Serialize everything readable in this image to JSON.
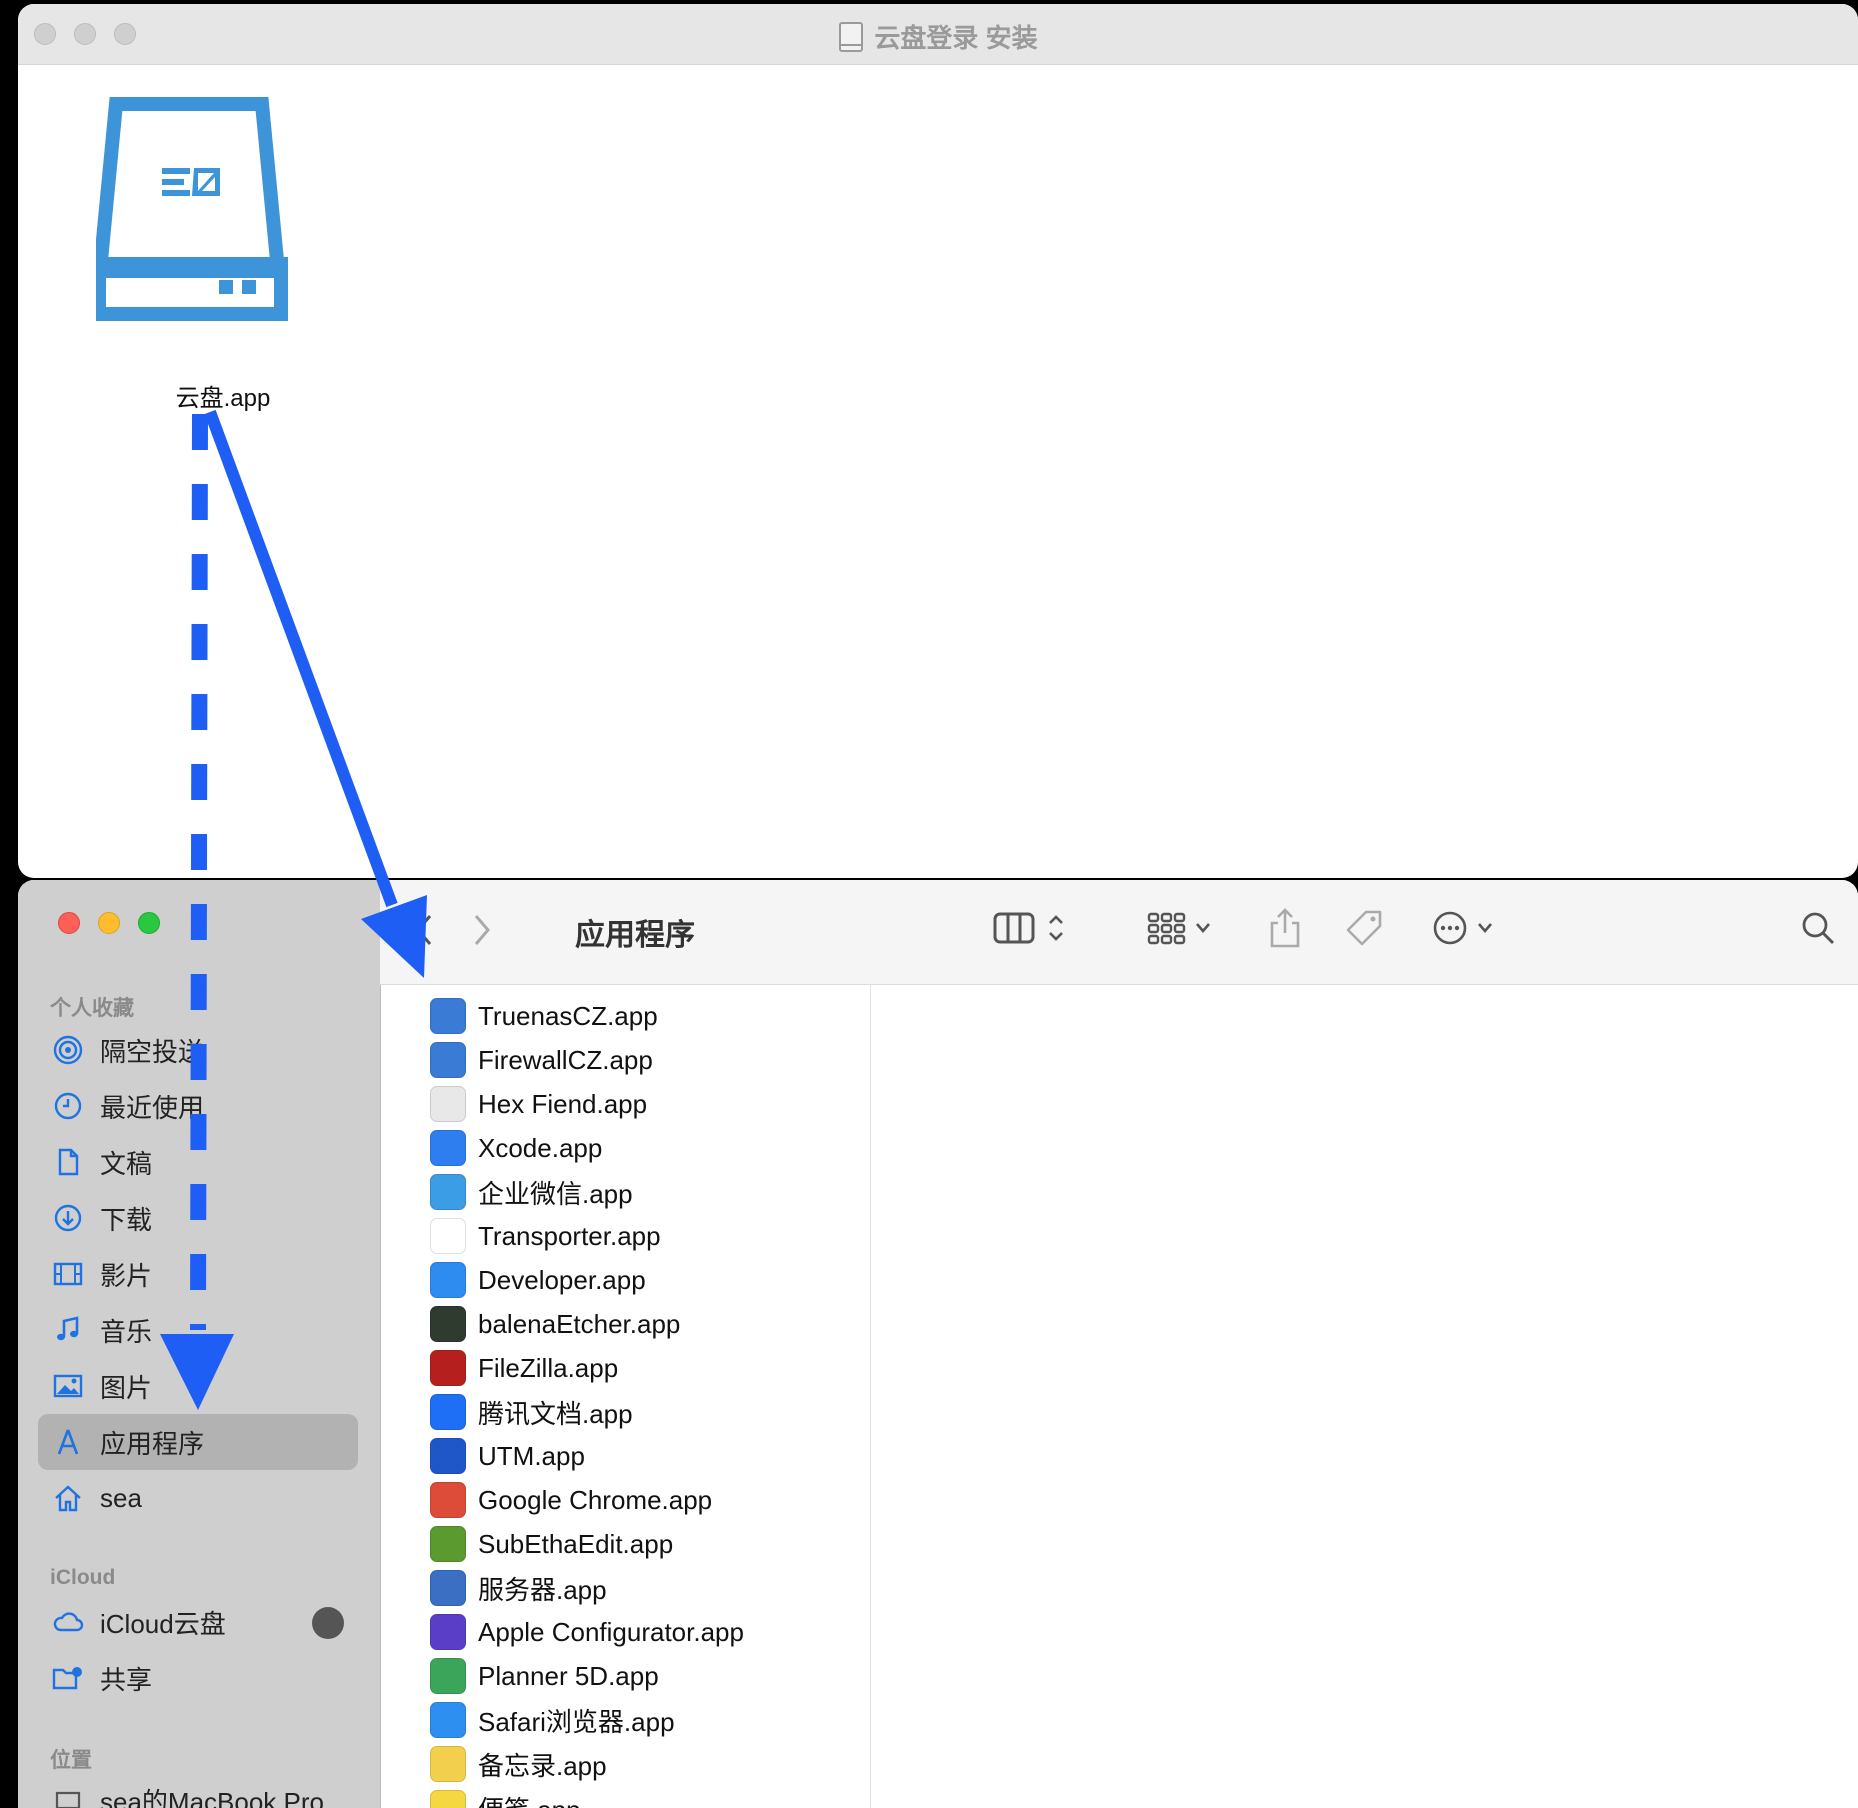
{
  "dmg": {
    "title": "云盘登录 安装",
    "app_label": "云盘.app",
    "brand_color": "#3d94d8"
  },
  "finder": {
    "title": "应用程序",
    "sidebar": {
      "favorites_header": "个人收藏",
      "favorites": [
        {
          "label": "隔空投送",
          "icon": "airdrop-icon"
        },
        {
          "label": "最近使用",
          "icon": "clock-icon"
        },
        {
          "label": "文稿",
          "icon": "document-icon"
        },
        {
          "label": "下载",
          "icon": "download-icon"
        },
        {
          "label": "影片",
          "icon": "film-icon"
        },
        {
          "label": "音乐",
          "icon": "music-icon"
        },
        {
          "label": "图片",
          "icon": "photo-icon"
        },
        {
          "label": "应用程序",
          "icon": "applications-icon",
          "selected": true
        },
        {
          "label": "sea",
          "icon": "home-icon"
        }
      ],
      "icloud_header": "iCloud",
      "icloud": [
        {
          "label": "iCloud云盘",
          "icon": "cloud-icon"
        },
        {
          "label": "共享",
          "icon": "shared-folder-icon"
        }
      ],
      "locations_header": "位置",
      "locations": [
        {
          "label": "sea的MacBook Pro",
          "icon": "laptop-icon"
        }
      ]
    },
    "files": [
      {
        "name": "TruenasCZ.app",
        "color": "#3a7bd5"
      },
      {
        "name": "FirewallCZ.app",
        "color": "#3a7bd5"
      },
      {
        "name": "Hex Fiend.app",
        "color": "#e8e8e8"
      },
      {
        "name": "Xcode.app",
        "color": "#2f7ef0"
      },
      {
        "name": "企业微信.app",
        "color": "#3b9de6"
      },
      {
        "name": "Transporter.app",
        "color": "#ffffff"
      },
      {
        "name": "Developer.app",
        "color": "#2e8bf0"
      },
      {
        "name": "balenaEtcher.app",
        "color": "#2f3b2f"
      },
      {
        "name": "FileZilla.app",
        "color": "#b5201e"
      },
      {
        "name": "腾讯文档.app",
        "color": "#1e6ff5"
      },
      {
        "name": "UTM.app",
        "color": "#1f57c8"
      },
      {
        "name": "Google Chrome.app",
        "color": "#dd4b39"
      },
      {
        "name": "SubEthaEdit.app",
        "color": "#5a9a2e"
      },
      {
        "name": "服务器.app",
        "color": "#3a6fc4"
      },
      {
        "name": "Apple Configurator.app",
        "color": "#5b3ec7"
      },
      {
        "name": "Planner 5D.app",
        "color": "#3ba55a"
      },
      {
        "name": "Safari浏览器.app",
        "color": "#2d8ff0"
      },
      {
        "name": "备忘录.app",
        "color": "#f2d04d"
      },
      {
        "name": "便笺.app",
        "color": "#f5d742"
      }
    ]
  },
  "annotation": {
    "arrow_color": "#1f5ef5"
  }
}
